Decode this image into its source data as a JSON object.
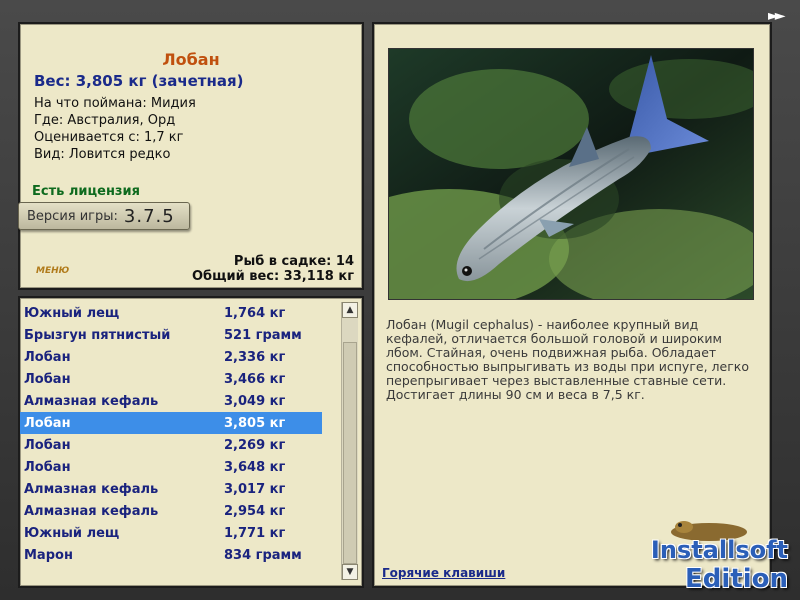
{
  "info": {
    "name": "Лобан",
    "weight_line": "Вес: 3,805 кг (зачетная)",
    "details": [
      "На что поймана: Мидия",
      "Где: Австралия, Орд",
      "Оценивается с: 1,7 кг",
      "Вид: Ловится редко"
    ],
    "license": "Есть лицензия",
    "version_label": "Версия игры:",
    "version_number": "3.7.5",
    "menu_logo": "МЕНЮ",
    "fish_in_tank": "Рыб в садке: 14",
    "total_weight": "Общий вес: 33,118 кг"
  },
  "catch_list": {
    "selected_index": 5,
    "items": [
      {
        "name": "Южный лещ",
        "weight": "1,764 кг"
      },
      {
        "name": "Брызгун пятнистый",
        "weight": "521 грамм"
      },
      {
        "name": "Лобан",
        "weight": "2,336 кг"
      },
      {
        "name": "Лобан",
        "weight": "3,466 кг"
      },
      {
        "name": "Алмазная кефаль",
        "weight": "3,049 кг"
      },
      {
        "name": "Лобан",
        "weight": "3,805 кг"
      },
      {
        "name": "Лобан",
        "weight": "2,269 кг"
      },
      {
        "name": "Лобан",
        "weight": "3,648 кг"
      },
      {
        "name": "Алмазная кефаль",
        "weight": "3,017 кг"
      },
      {
        "name": "Алмазная кефаль",
        "weight": "2,954 кг"
      },
      {
        "name": "Южный лещ",
        "weight": "1,771 кг"
      },
      {
        "name": "Марон",
        "weight": "834 грамм"
      }
    ]
  },
  "right": {
    "description": "Лобан (Mugil cephalus) - наиболее крупный вид кефалей, отличается большой головой и широким лбом. Стайная, очень подвижная рыба. Обладает способностью выпрыгивать из воды при испуге, легко перепрыгивает через выставленные ставные сети. Достигает длины 90 см и веса в 7,5 кг.",
    "hotkeys": "Горячие клавиши"
  },
  "watermark": {
    "line1": "Installsoft",
    "line2": "Edition"
  },
  "icons": {
    "next": "double-chevron-right-icon",
    "scroll_up": "chevron-up-icon",
    "scroll_down": "chevron-down-icon"
  }
}
